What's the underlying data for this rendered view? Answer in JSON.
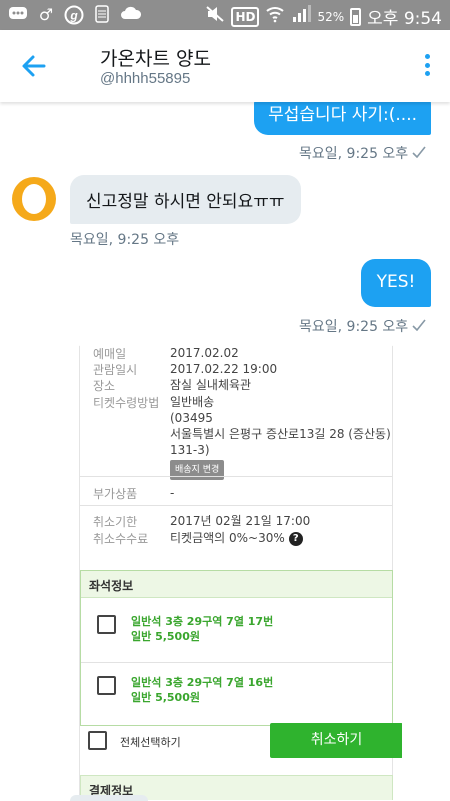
{
  "status_bar": {
    "battery": "52%",
    "time": "오후 9:54",
    "icons": [
      "chat-icon",
      "male-icon",
      "g-icon",
      "sim-icon",
      "cloud-icon",
      "mute-icon",
      "hd-icon",
      "wifi-icon",
      "signal-icon",
      "battery-icon"
    ]
  },
  "header": {
    "title": "가온차트 양도",
    "handle": "@hhhh55895"
  },
  "messages": [
    {
      "direction": "out",
      "text": "무섭습니다 사기:(....",
      "time": "목요일, 9:25 오후"
    },
    {
      "direction": "in",
      "text": "신고정말 하시면 안되요ㅠㅠ",
      "time": "목요일, 9:25 오후"
    },
    {
      "direction": "out",
      "text": "YES!",
      "time": "목요일, 9:25 오후"
    }
  ],
  "ticket": {
    "rows": [
      {
        "label": "예매일",
        "value": "2017.02.02"
      },
      {
        "label": "관람일시",
        "value": "2017.02.22 19:00"
      },
      {
        "label": "장소",
        "value": "잠실 실내체육관"
      },
      {
        "label": "티켓수령방법",
        "lines": [
          "일반배송",
          "(03495",
          "서울특별시 은평구 증산로13길 28 (증산동)",
          "131-3)"
        ],
        "button": "배송지 변경"
      },
      {
        "label": "부가상품",
        "value": "-"
      },
      {
        "label": "취소기한",
        "value": "2017년 02월 21일 17:00"
      },
      {
        "label": "취소수수료",
        "value": "티켓금액의 0%~30%"
      }
    ],
    "seat_header": "좌석정보",
    "seats": [
      {
        "line1": "일반석 3층 29구역 7열 17번",
        "line2": "일반 5,500원"
      },
      {
        "line1": "일반석 3층 29구역 7열 16번",
        "line2": "일반 5,500원"
      }
    ],
    "select_all": "전체선택하기",
    "cancel": "취소하기",
    "payment_header": "결제정보"
  },
  "colors": {
    "accent": "#1da1f2",
    "green": "#2fb32e",
    "avatar": "#f5a91a"
  }
}
